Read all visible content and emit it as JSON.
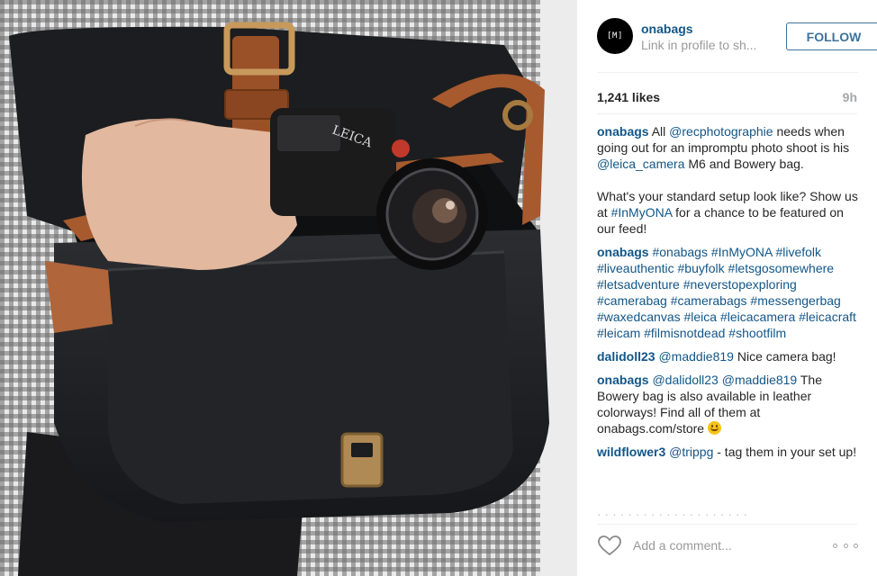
{
  "post": {
    "username": "onabags",
    "profile_sub": "Link in profile to sh...",
    "avatar_mark": "[M]",
    "follow_label": "FOLLOW",
    "likes": "1,241 likes",
    "time_ago": "9h",
    "add_comment_placeholder": "Add a comment...",
    "faded_row": "· · · · · · · · · · · · · · · · · · · ·"
  },
  "caption": {
    "user": "onabags",
    "p1_a": "All ",
    "p1_mention": "@recphotographie",
    "p1_b": " needs when going out for an impromptu photo shoot is his ",
    "p1_mention2": "@leica_camera",
    "p1_c": " M6 and Bowery bag.",
    "p2_a": "What's your standard setup look like? Show us at ",
    "p2_tag": "#InMyONA",
    "p2_b": " for a chance to be featured on our feed!"
  },
  "comments": [
    {
      "user": "onabags",
      "text": "#onabags #InMyONA #livefolk #liveauthentic #buyfolk #letsgosomewhere #letsadventure #neverstopexploring #camerabag #camerabags #messengerbag #waxedcanvas #leica #leicacamera #leicacraft #leicam #filmisnotdead #shootfilm"
    },
    {
      "user": "dalidoll23",
      "mention": "@maddie819",
      "text": " Nice camera bag!"
    },
    {
      "user": "onabags",
      "mention": "@dalidoll23 @maddie819",
      "text": " The Bowery bag is also available in leather colorways! Find all of them at onabags.com/store "
    },
    {
      "user": "wildflower3",
      "mention": "@trippg",
      "text": " - tag them in your set up!"
    }
  ],
  "photo": {
    "camera_brand": "LEICA",
    "camera_model": "M6"
  },
  "colors": {
    "link": "#125688",
    "follow": "#3f729b",
    "muted": "#999999",
    "bag_canvas": "#1e2023",
    "leather": "#a65a2e"
  },
  "icons": {
    "like": "heart-icon",
    "options": "more-options-icon",
    "emoji": "smiley-emoji-icon"
  }
}
